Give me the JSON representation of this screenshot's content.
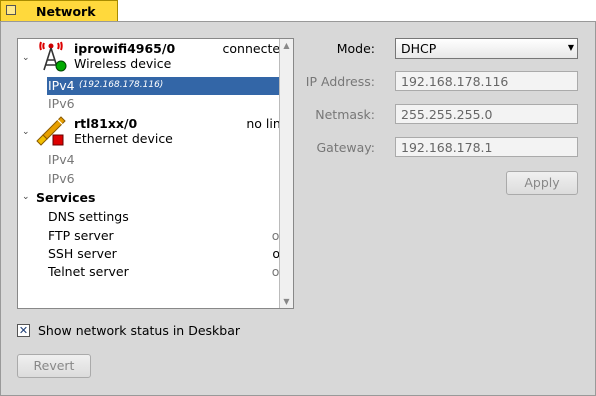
{
  "window": {
    "title": "Network"
  },
  "devices": [
    {
      "name": "iprowifi4965/0",
      "type": "Wireless device",
      "status": "connected",
      "ipv4": "IPv4",
      "ipv4_addr": "(192.168.178.116)",
      "ipv6": "IPv6",
      "icon": "wifi-antenna-icon"
    },
    {
      "name": "rtl81xx/0",
      "type": "Ethernet device",
      "status": "no link",
      "ipv4": "IPv4",
      "ipv6": "IPv6",
      "icon": "ethernet-plug-icon"
    }
  ],
  "services": {
    "header": "Services",
    "items": [
      {
        "name": "DNS settings",
        "state": ""
      },
      {
        "name": "FTP server",
        "state": "off"
      },
      {
        "name": "SSH server",
        "state": "on"
      },
      {
        "name": "Telnet server",
        "state": "off"
      }
    ]
  },
  "form": {
    "mode_label": "Mode:",
    "mode_value": "DHCP",
    "ip_label": "IP Address:",
    "ip_value": "192.168.178.116",
    "netmask_label": "Netmask:",
    "netmask_value": "255.255.255.0",
    "gateway_label": "Gateway:",
    "gateway_value": "192.168.178.1",
    "apply": "Apply"
  },
  "deskbar": {
    "label": "Show network status in Deskbar",
    "checked": true,
    "mark": "✕"
  },
  "revert": "Revert"
}
